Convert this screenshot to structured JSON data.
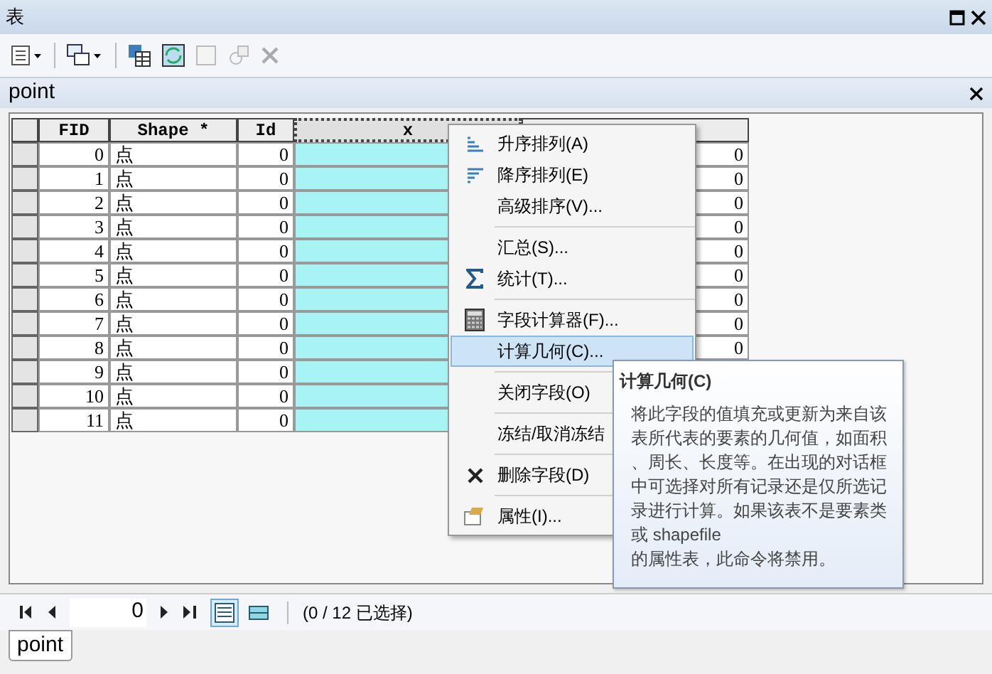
{
  "window": {
    "title": "表"
  },
  "table_title": "point",
  "columns": [
    {
      "label": "FID",
      "selected": false
    },
    {
      "label": "Shape *",
      "selected": false
    },
    {
      "label": "Id",
      "selected": false
    },
    {
      "label": "x",
      "selected": true
    },
    {
      "selected": false
    }
  ],
  "rows": [
    {
      "fid": "0",
      "shape": "点",
      "id": "0",
      "column_5": "0"
    },
    {
      "fid": "1",
      "shape": "点",
      "id": "0",
      "column_5": "0"
    },
    {
      "fid": "2",
      "shape": "点",
      "id": "0",
      "column_5": "0"
    },
    {
      "fid": "3",
      "shape": "点",
      "id": "0",
      "column_5": "0"
    },
    {
      "fid": "4",
      "shape": "点",
      "id": "0",
      "column_5": "0"
    },
    {
      "fid": "5",
      "shape": "点",
      "id": "0",
      "column_5": "0"
    },
    {
      "fid": "6",
      "shape": "点",
      "id": "0",
      "column_5": "0"
    },
    {
      "fid": "7",
      "shape": "点",
      "id": "0",
      "column_5": "0"
    },
    {
      "fid": "8",
      "shape": "点",
      "id": "0",
      "column_5": "0"
    },
    {
      "fid": "9",
      "shape": "点",
      "id": "0"
    },
    {
      "fid": "10",
      "shape": "点",
      "id": "0"
    },
    {
      "fid": "11",
      "shape": "点",
      "id": "0"
    }
  ],
  "context_menu": [
    {
      "kind": "item",
      "label": "升序排列(A)",
      "selected": false
    },
    {
      "kind": "item",
      "label": "降序排列(E)",
      "selected": false
    },
    {
      "kind": "item",
      "label": "高级排序(V)...",
      "selected": false
    },
    {
      "kind": "separator"
    },
    {
      "kind": "item",
      "label": "汇总(S)...",
      "selected": false
    },
    {
      "kind": "item",
      "label": "统计(T)...",
      "selected": false
    },
    {
      "kind": "separator"
    },
    {
      "kind": "item",
      "label": "字段计算器(F)...",
      "selected": false
    },
    {
      "kind": "item",
      "label": "计算几何(C)...",
      "selected": true
    },
    {
      "kind": "separator"
    },
    {
      "kind": "item",
      "label": "关闭字段(O)",
      "selected": false
    },
    {
      "kind": "separator"
    },
    {
      "kind": "item",
      "label": "冻结/取消冻结",
      "selected": false
    },
    {
      "kind": "separator"
    },
    {
      "kind": "item",
      "label": "删除字段(D)",
      "selected": false
    },
    {
      "kind": "separator"
    },
    {
      "kind": "item",
      "label": "属性(I)...",
      "selected": false
    }
  ],
  "tooltip": {
    "title": "计算几何(C)",
    "body": "将此字段的值填充或更新为来自该表所代表的要素的几何值，如面积、周长、长度等。在出现的对话框中可选择对所有记录还是仅所选记录进行计算。如果该表不是要素类或 shapefile\n的属性表，此命令将禁用。"
  },
  "navigator": {
    "record": "0",
    "views": [
      {
        "selected": true
      },
      {
        "selected": false
      }
    ],
    "selection": "(0 / 12 已选择)"
  },
  "tabs": [
    {
      "label": "point",
      "selected": true
    }
  ]
}
